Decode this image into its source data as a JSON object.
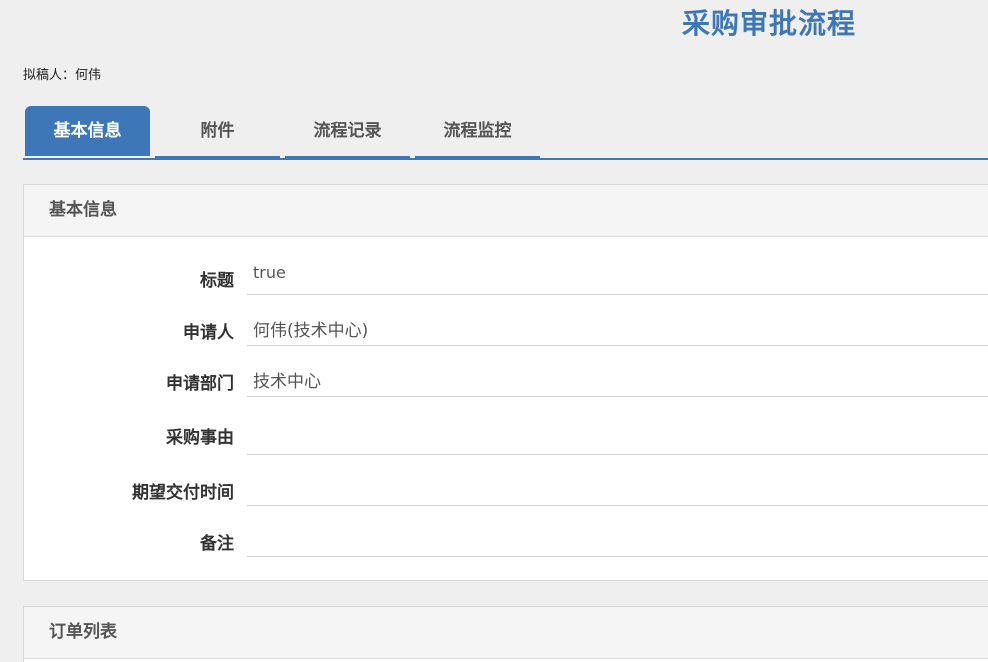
{
  "header": {
    "title": "采购审批流程",
    "drafter_label": "拟稿人：",
    "drafter_name": "何伟"
  },
  "tabs": [
    {
      "label": "基本信息",
      "active": true
    },
    {
      "label": "附件",
      "active": false
    },
    {
      "label": "流程记录",
      "active": false
    },
    {
      "label": "流程监控",
      "active": false
    }
  ],
  "basic_info": {
    "heading": "基本信息",
    "fields": [
      {
        "label": "标题",
        "value": "true"
      },
      {
        "label": "申请人",
        "value": "何伟(技术中心)"
      },
      {
        "label": "申请部门",
        "value": "技术中心"
      },
      {
        "label": "采购事由",
        "value": ""
      },
      {
        "label": "期望交付时间",
        "value": ""
      },
      {
        "label": "备注",
        "value": ""
      }
    ]
  },
  "order_list": {
    "heading": "订单列表"
  },
  "colors": {
    "accent": "#3e77b8",
    "background": "#efefef",
    "panel_header": "#f5f5f5"
  }
}
